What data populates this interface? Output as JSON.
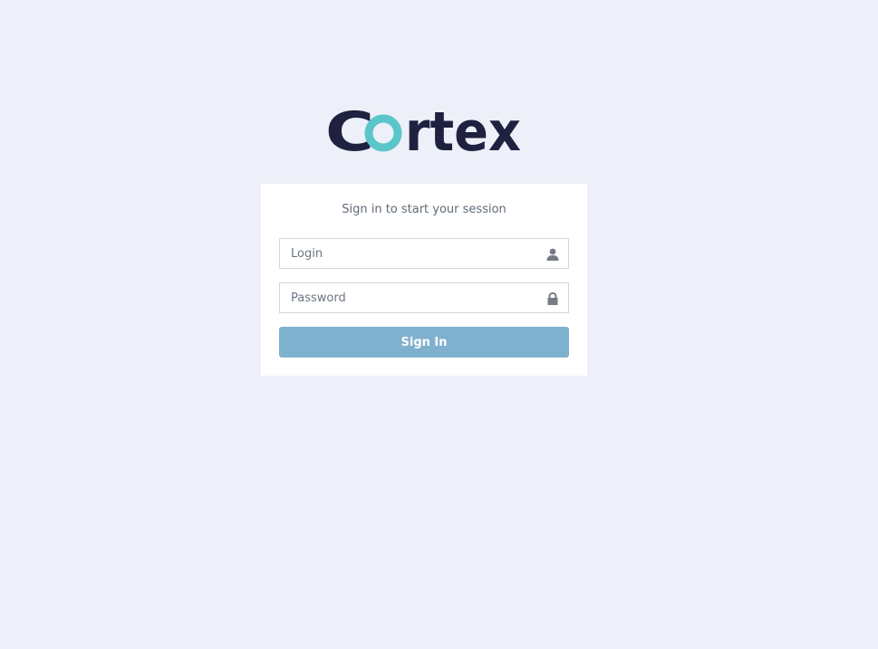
{
  "brand": {
    "name": "Cortex",
    "text_color": "#1f2140",
    "accent_color": "#5bc6c9"
  },
  "login_box": {
    "message": "Sign in to start your session",
    "login_field": {
      "placeholder": "Login",
      "value": "",
      "icon": "user-icon"
    },
    "password_field": {
      "placeholder": "Password",
      "value": "",
      "icon": "lock-icon"
    },
    "submit_label": "Sign In",
    "submit_color": "#7fb1cf"
  },
  "background_color": "#edf0f8"
}
